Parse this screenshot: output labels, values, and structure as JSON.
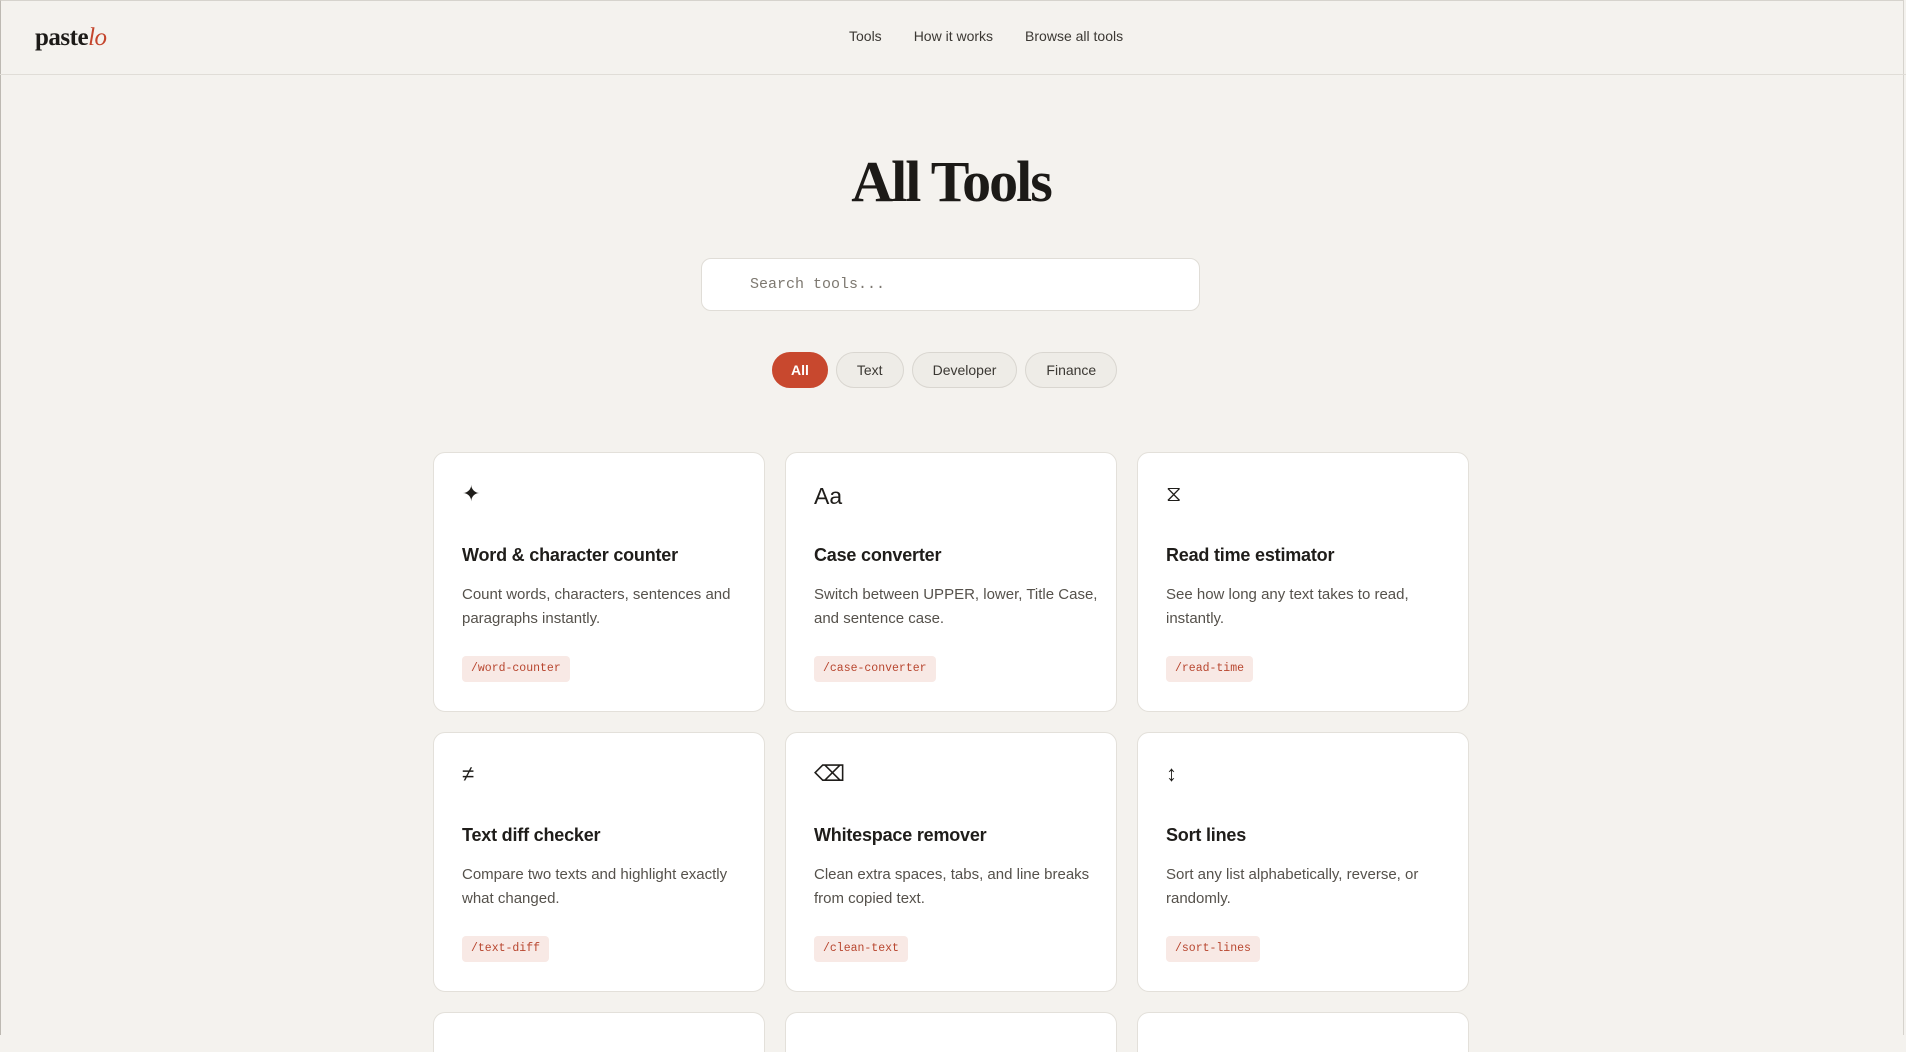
{
  "brand": {
    "name_main": "paste",
    "name_accent": "lo"
  },
  "nav": {
    "items": [
      {
        "label": "Tools"
      },
      {
        "label": "How it works"
      },
      {
        "label": "Browse all tools"
      }
    ]
  },
  "page": {
    "title": "All Tools"
  },
  "search": {
    "placeholder": "Search tools..."
  },
  "filters": {
    "selected": "All",
    "items": [
      {
        "label": "All"
      },
      {
        "label": "Text"
      },
      {
        "label": "Developer"
      },
      {
        "label": "Finance"
      }
    ]
  },
  "tools": [
    {
      "icon": "sparkle-icon",
      "glyph": "✦",
      "title": "Word & character counter",
      "description": "Count words, characters, sentences and paragraphs instantly.",
      "slug": "/word-counter"
    },
    {
      "icon": "text-case-icon",
      "glyph": "Aa",
      "title": "Case converter",
      "description": "Switch between UPPER, lower, Title Case, and sentence case.",
      "slug": "/case-converter"
    },
    {
      "icon": "hourglass-icon",
      "glyph": "⧖",
      "title": "Read time estimator",
      "description": "See how long any text takes to read, instantly.",
      "slug": "/read-time"
    },
    {
      "icon": "not-equal-icon",
      "glyph": "≠",
      "title": "Text diff checker",
      "description": "Compare two texts and highlight exactly what changed.",
      "slug": "/text-diff"
    },
    {
      "icon": "erase-icon",
      "glyph": "⌫",
      "title": "Whitespace remover",
      "description": "Clean extra spaces, tabs, and line breaks from copied text.",
      "slug": "/clean-text"
    },
    {
      "icon": "sort-arrows-icon",
      "glyph": "↕",
      "title": "Sort lines",
      "description": "Sort any list alphabetically, reverse, or randomly.",
      "slug": "/sort-lines"
    }
  ],
  "colors": {
    "accent": "#c8482e",
    "background": "#f4f2ee",
    "card": "#ffffff",
    "slug_bg": "#f8e9e5",
    "slug_text": "#b8462f"
  }
}
